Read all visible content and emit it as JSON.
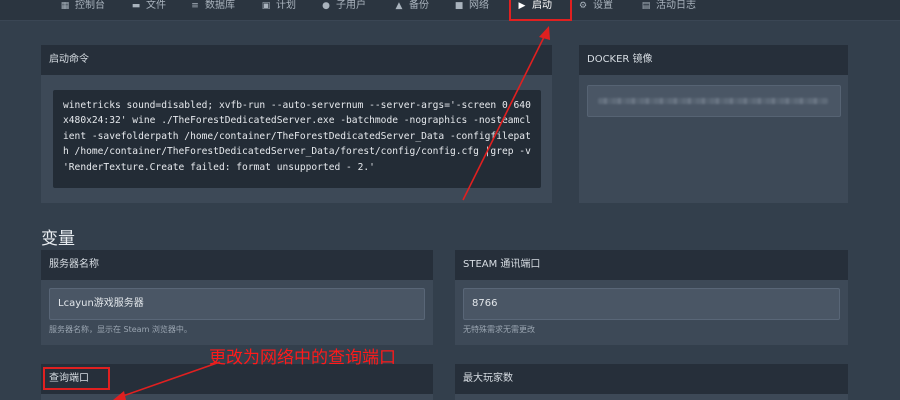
{
  "nav": {
    "tabs": [
      {
        "label": "控制台",
        "icon": "dashboard-icon"
      },
      {
        "label": "文件",
        "icon": "folder-icon"
      },
      {
        "label": "数据库",
        "icon": "database-icon"
      },
      {
        "label": "计划",
        "icon": "calendar-icon"
      },
      {
        "label": "子用户",
        "icon": "users-icon"
      },
      {
        "label": "备份",
        "icon": "upload-icon"
      },
      {
        "label": "网络",
        "icon": "network-icon"
      },
      {
        "label": "启动",
        "icon": "play-icon",
        "active": true
      },
      {
        "label": "设置",
        "icon": "gear-icon"
      },
      {
        "label": "活动日志",
        "icon": "log-icon"
      }
    ]
  },
  "startup": {
    "title": "启动命令",
    "command": "winetricks sound=disabled; xvfb-run --auto-servernum --server-args='-screen 0 640x480x24:32' wine ./TheForestDedicatedServer.exe -batchmode -nographics -nosteamclient -savefolderpath /home/container/TheForestDedicatedServer_Data -configfilepath /home/container/TheForestDedicatedServer_Data/forest/config/config.cfg |grep -v 'RenderTexture.Create failed: format unsupported - 2.'"
  },
  "docker": {
    "title": "DOCKER 镜像"
  },
  "variables": {
    "title": "变量",
    "server_name": {
      "label": "服务器名称",
      "value": "Lcayun游戏服务器",
      "hint": "服务器名称，显示在 Steam 浏览器中。"
    },
    "steam_port": {
      "label": "STEAM 通讯端口",
      "value": "8766",
      "hint": "无特殊需求无需更改"
    },
    "query_port": {
      "label": "查询端口"
    },
    "max_players": {
      "label": "最大玩家数"
    }
  },
  "annotation": {
    "text": "更改为网络中的查询端口",
    "color": "#ff1a1a"
  },
  "colors": {
    "background": "#333f4c",
    "panel": "#3d4957",
    "panel_header": "#262f3a",
    "highlight": "#e02020"
  }
}
